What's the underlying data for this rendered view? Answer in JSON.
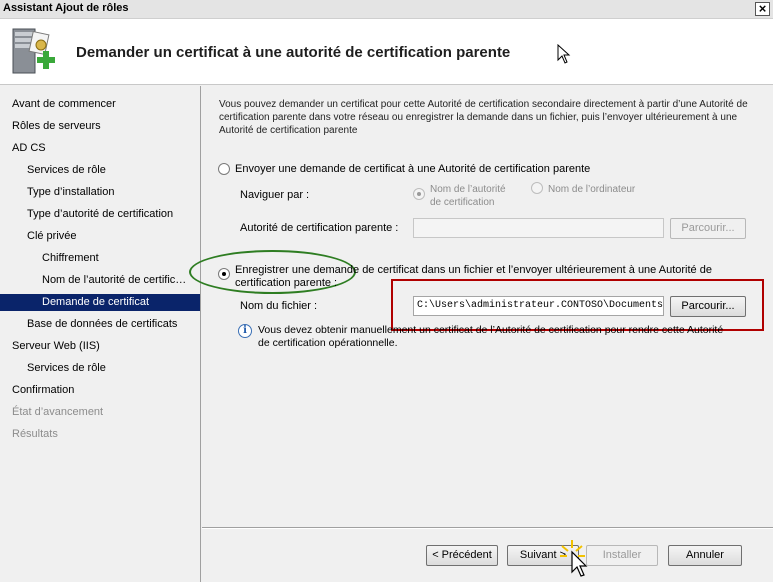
{
  "window": {
    "title": "Assistant Ajout de rôles",
    "close_label": "×"
  },
  "header": {
    "heading": "Demander un certificat à une autorité de certification parente"
  },
  "nav": {
    "items": [
      {
        "label": "Avant de commencer",
        "level": 0,
        "state": "normal"
      },
      {
        "label": "Rôles de serveurs",
        "level": 0,
        "state": "normal"
      },
      {
        "label": "AD CS",
        "level": 0,
        "state": "normal"
      },
      {
        "label": "Services de rôle",
        "level": 1,
        "state": "normal"
      },
      {
        "label": "Type d’installation",
        "level": 1,
        "state": "normal"
      },
      {
        "label": "Type d’autorité de certification",
        "level": 1,
        "state": "normal"
      },
      {
        "label": "Clé privée",
        "level": 1,
        "state": "normal"
      },
      {
        "label": "Chiffrement",
        "level": 2,
        "state": "normal"
      },
      {
        "label": "Nom de l’autorité de certific…",
        "level": 2,
        "state": "normal"
      },
      {
        "label": "Demande de certificat",
        "level": 2,
        "state": "active"
      },
      {
        "label": "Base de données de certificats",
        "level": 1,
        "state": "normal"
      },
      {
        "label": "Serveur Web (IIS)",
        "level": 0,
        "state": "normal"
      },
      {
        "label": "Services de rôle",
        "level": 1,
        "state": "normal"
      },
      {
        "label": "Confirmation",
        "level": 0,
        "state": "normal"
      },
      {
        "label": "État d’avancement",
        "level": 0,
        "state": "disabled"
      },
      {
        "label": "Résultats",
        "level": 0,
        "state": "disabled"
      }
    ]
  },
  "main": {
    "intro": "Vous pouvez demander un certificat pour cette Autorité de certification secondaire directement à partir d’une Autorité de certification parente dans votre réseau ou enregistrer la demande dans un fichier, puis l’envoyer ultérieurement à une Autorité de certification parente",
    "option_send": {
      "label": "Envoyer une demande de certificat à une Autorité de certification parente",
      "checked": false,
      "browse_by_label": "Naviguer par :",
      "browse_ca_name_label": "Nom de l’autorité de certification",
      "browse_ca_name_line1": "Nom de l’autorité",
      "browse_ca_name_line2": "de certification",
      "browse_computer_label": "Nom de l’ordinateur",
      "parent_ca_label": "Autorité de certification parente :",
      "parent_ca_value": "",
      "browse_button": "Parcourir..."
    },
    "option_save": {
      "label_line1": "Enregistrer une demande de certificat dans un fichier et l’envoyer ultérieurement à une Autorité de",
      "label_line2": "certification parente :",
      "checked": true,
      "filename_label": "Nom du fichier :",
      "filename_value": "C:\\Users\\administrateur.CONTOSO\\Documents\\SERVEUR",
      "browse_button": "Parcourir...",
      "info_line1": "Vous devez obtenir manuellement un certificat de l’Autorité de certification pour rendre cette Autorité",
      "info_line2": "de certification opérationnelle."
    }
  },
  "footer": {
    "previous": "< Précédent",
    "next": "Suivant >",
    "install": "Installer",
    "cancel": "Annuler"
  },
  "colors": {
    "selection": "#0a246a",
    "highlight_red": "#b00000",
    "highlight_green": "#2e7d22"
  }
}
